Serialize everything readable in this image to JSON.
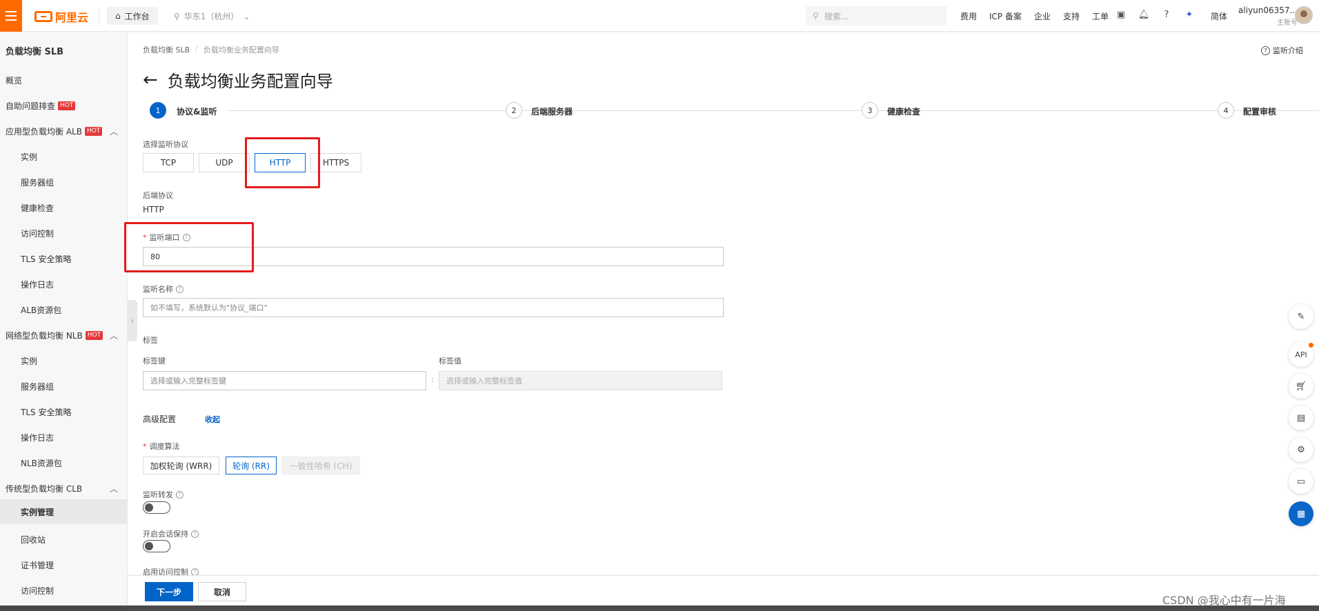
{
  "topbar": {
    "logo": "阿里云",
    "workbench": "工作台",
    "region": "华东1（杭州）",
    "search_placeholder": "搜索...",
    "nav": [
      "费用",
      "ICP 备案",
      "企业",
      "支持",
      "工单"
    ],
    "lang": "简体",
    "account_name": "aliyun06357...",
    "account_sub": "主账号"
  },
  "sidebar": {
    "title": "负载均衡 SLB",
    "overview": "概览",
    "self_check": "自助问题排查",
    "hot": "HOT",
    "alb": {
      "label": "应用型负载均衡 ALB",
      "items": [
        "实例",
        "服务器组",
        "健康检查",
        "访问控制",
        "TLS 安全策略",
        "操作日志",
        "ALB资源包"
      ]
    },
    "nlb": {
      "label": "网络型负载均衡 NLB",
      "items": [
        "实例",
        "服务器组",
        "TLS 安全策略",
        "操作日志",
        "NLB资源包"
      ]
    },
    "clb": {
      "label": "传统型负载均衡 CLB",
      "items": [
        "实例管理",
        "回收站",
        "证书管理",
        "访问控制"
      ]
    }
  },
  "breadcrumb": [
    "负载均衡 SLB",
    "负载均衡业务配置向导"
  ],
  "help_link": "监听介绍",
  "page_title": "负载均衡业务配置向导",
  "steps": [
    {
      "num": "1",
      "label": "协议&监听"
    },
    {
      "num": "2",
      "label": "后端服务器"
    },
    {
      "num": "3",
      "label": "健康检查"
    },
    {
      "num": "4",
      "label": "配置审核"
    }
  ],
  "form": {
    "protocol_label": "选择监听协议",
    "protocols": [
      "TCP",
      "UDP",
      "HTTP",
      "HTTPS"
    ],
    "selected_protocol": "HTTP",
    "backend_protocol_label": "后端协议",
    "backend_protocol_value": "HTTP",
    "port_label": "监听端口",
    "port_value": "80",
    "name_label": "监听名称",
    "name_placeholder": "如不填写，系统默认为\"协议_端口\"",
    "tags_label": "标签",
    "tag_key_label": "标签键",
    "tag_key_placeholder": "选择或输入完整标签键",
    "tag_value_label": "标签值",
    "tag_value_placeholder": "选择或输入完整标签值",
    "advanced_label": "高级配置",
    "advanced_toggle": "收起",
    "algo_label": "调度算法",
    "algos": [
      "加权轮询 (WRR)",
      "轮询 (RR)",
      "一致性哈希 (CH)"
    ],
    "selected_algo": "轮询 (RR)",
    "forward_label": "监听转发",
    "session_label": "开启会话保持",
    "acl_label": "启用访问控制"
  },
  "footer": {
    "next": "下一步",
    "cancel": "取消"
  },
  "float_bar": {
    "api": "API"
  },
  "watermark": "CSDN @我心中有一片海",
  "colors": {
    "accent": "#0064c8",
    "brand": "#ff6a00",
    "highlight": "#e21b1b"
  }
}
